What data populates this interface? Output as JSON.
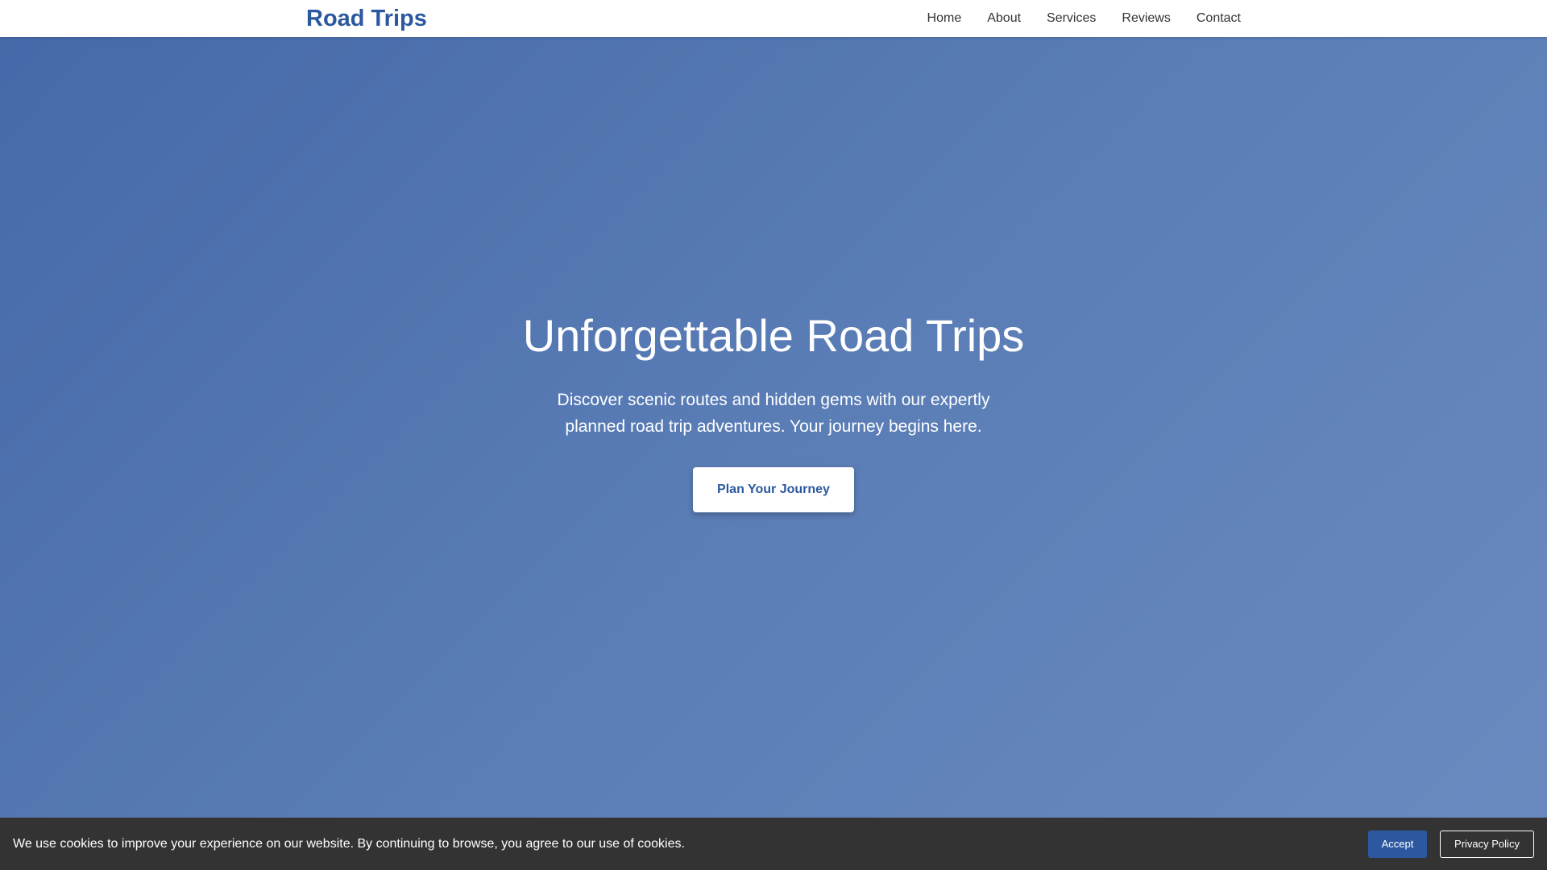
{
  "header": {
    "brand": "Road Trips",
    "nav": [
      {
        "label": "Home"
      },
      {
        "label": "About"
      },
      {
        "label": "Services"
      },
      {
        "label": "Reviews"
      },
      {
        "label": "Contact"
      }
    ]
  },
  "hero": {
    "title": "Unforgettable Road Trips",
    "subtitle": "Discover scenic routes and hidden gems with our expertly planned road trip adventures. Your journey begins here.",
    "cta_label": "Plan Your Journey"
  },
  "cookie_banner": {
    "message": "We use cookies to improve your experience on our website. By continuing to browse, you agree to our use of cookies.",
    "accept_label": "Accept",
    "privacy_label": "Privacy Policy"
  },
  "colors": {
    "brand": "#2c58a0",
    "hero_gradient_start": "#4569a8",
    "hero_gradient_end": "#6a8bc0",
    "banner_bg": "#333333"
  }
}
